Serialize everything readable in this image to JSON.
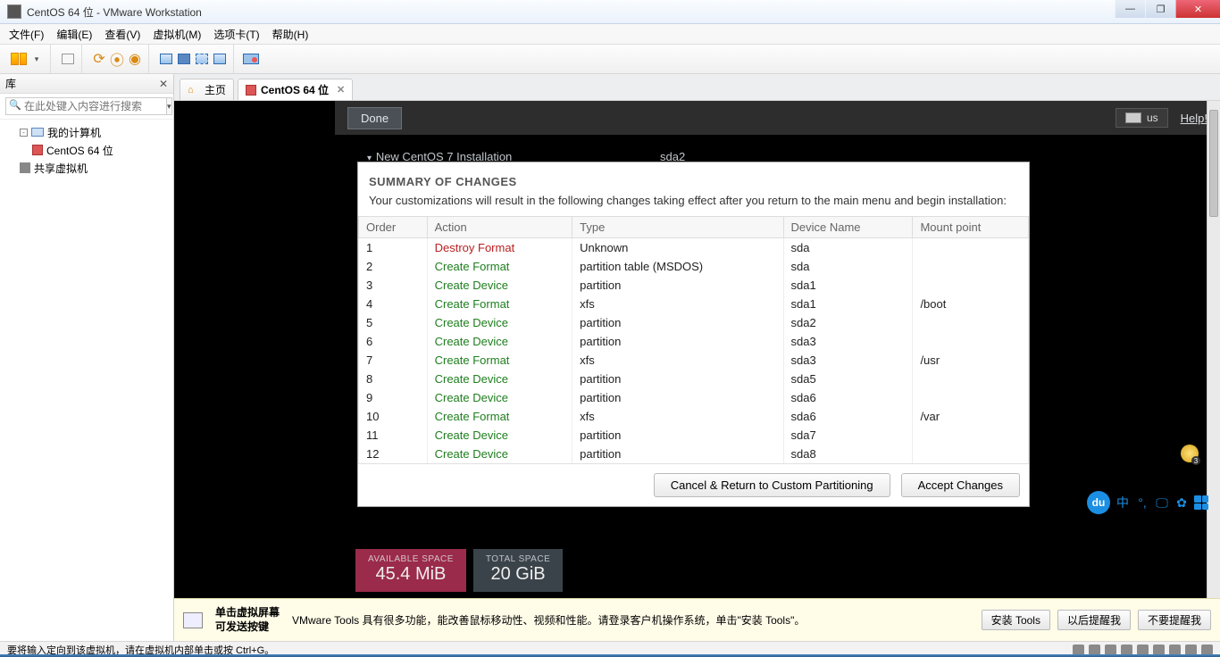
{
  "window": {
    "title": "CentOS 64 位 - VMware Workstation"
  },
  "menu": {
    "file": "文件(F)",
    "edit": "编辑(E)",
    "view": "查看(V)",
    "vm": "虚拟机(M)",
    "tabs": "选项卡(T)",
    "help": "帮助(H)"
  },
  "sidebar": {
    "title": "库",
    "search_placeholder": "在此处键入内容进行搜索",
    "root": "我的计算机",
    "vm_item": "CentOS 64 位",
    "shared": "共享虚拟机"
  },
  "tabs": {
    "home": "主页",
    "vm": "CentOS 64 位"
  },
  "anaconda": {
    "done": "Done",
    "kb": "us",
    "help": "Help!",
    "new_install": "New CentOS 7 Installation",
    "right_dev": "sda2"
  },
  "dialog": {
    "title": "SUMMARY OF CHANGES",
    "desc": "Your customizations will result in the following changes taking effect after you return to the main menu and begin installation:",
    "headers": {
      "order": "Order",
      "action": "Action",
      "type": "Type",
      "device": "Device Name",
      "mount": "Mount point"
    },
    "rows": [
      {
        "order": "1",
        "action": "Destroy Format",
        "ac": "act-destroy",
        "type": "Unknown",
        "device": "sda",
        "mount": ""
      },
      {
        "order": "2",
        "action": "Create Format",
        "ac": "act-create",
        "type": "partition table (MSDOS)",
        "device": "sda",
        "mount": ""
      },
      {
        "order": "3",
        "action": "Create Device",
        "ac": "act-create",
        "type": "partition",
        "device": "sda1",
        "mount": ""
      },
      {
        "order": "4",
        "action": "Create Format",
        "ac": "act-create",
        "type": "xfs",
        "device": "sda1",
        "mount": "/boot"
      },
      {
        "order": "5",
        "action": "Create Device",
        "ac": "act-create",
        "type": "partition",
        "device": "sda2",
        "mount": ""
      },
      {
        "order": "6",
        "action": "Create Device",
        "ac": "act-create",
        "type": "partition",
        "device": "sda3",
        "mount": ""
      },
      {
        "order": "7",
        "action": "Create Format",
        "ac": "act-create",
        "type": "xfs",
        "device": "sda3",
        "mount": "/usr"
      },
      {
        "order": "8",
        "action": "Create Device",
        "ac": "act-create",
        "type": "partition",
        "device": "sda5",
        "mount": ""
      },
      {
        "order": "9",
        "action": "Create Device",
        "ac": "act-create",
        "type": "partition",
        "device": "sda6",
        "mount": ""
      },
      {
        "order": "10",
        "action": "Create Format",
        "ac": "act-create",
        "type": "xfs",
        "device": "sda6",
        "mount": "/var"
      },
      {
        "order": "11",
        "action": "Create Device",
        "ac": "act-create",
        "type": "partition",
        "device": "sda7",
        "mount": ""
      },
      {
        "order": "12",
        "action": "Create Device",
        "ac": "act-create",
        "type": "partition",
        "device": "sda8",
        "mount": ""
      }
    ],
    "cancel": "Cancel & Return to Custom Partitioning",
    "accept": "Accept Changes"
  },
  "space": {
    "avail_lbl": "AVAILABLE SPACE",
    "avail_val": "45.4 MiB",
    "total_lbl": "TOTAL SPACE",
    "total_val": "20 GiB"
  },
  "banner": {
    "lead1": "单击虚拟屏幕",
    "lead2": "可发送按键",
    "msg": "VMware Tools 具有很多功能，能改善鼠标移动性、视频和性能。请登录客户机操作系统，单击\"安装 Tools\"。",
    "install": "安装 Tools",
    "later": "以后提醒我",
    "never": "不要提醒我"
  },
  "status": {
    "text": "要将输入定向到该虚拟机，请在虚拟机内部单击或按 Ctrl+G。"
  },
  "coin": {
    "badge": "3"
  },
  "dock": {
    "zh": "中"
  }
}
